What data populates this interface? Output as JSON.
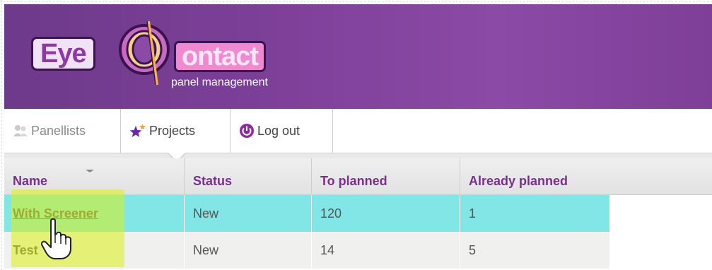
{
  "logo": {
    "word1": "Eye",
    "word2": "ontact",
    "subtitle": "panel management"
  },
  "nav": {
    "tabs": [
      {
        "label": "Panellists",
        "icon": "users-icon"
      },
      {
        "label": "Projects",
        "icon": "stars-icon"
      },
      {
        "label": "Log out",
        "icon": "power-icon"
      }
    ],
    "active_tab": "Projects"
  },
  "table": {
    "columns": [
      "Name",
      "Status",
      "To planned",
      "Already planned"
    ],
    "rows": [
      {
        "name": "With Screener",
        "status": "New",
        "to_planned": "120",
        "already_planned": "1"
      },
      {
        "name": "Test",
        "status": "New",
        "to_planned": "14",
        "already_planned": "5"
      }
    ]
  },
  "colors": {
    "header_purple": "#7c3f98",
    "heading_purple": "#7a2f8e",
    "selected_row": "#82e6e6",
    "highlight": "#dcf014"
  }
}
